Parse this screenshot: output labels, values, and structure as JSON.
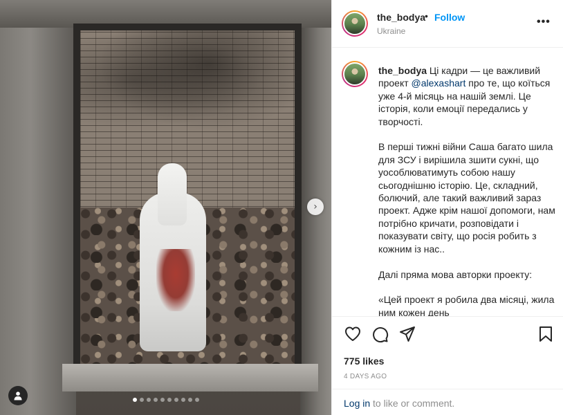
{
  "post": {
    "username": "the_bodya",
    "bullet": "•",
    "follow_label": "Follow",
    "location": "Ukraine",
    "more_label": "•••",
    "caption": {
      "username": "the_bodya",
      "text_before_mention": " Ці кадри — це важливий проект ",
      "mention": "@alexashart",
      "text_after_mention": " про те, що коїться уже 4-й місяць на нашій землі. Це історія, коли емоції передались у творчості.\n\nВ перші тижні війни Саша багато шила для ЗСУ і вирішила зшити сукні, що уособлюватимуть собою нашу сьогоднішню історію. Це, складний, болючий, але такий важливий зараз проект. Адже крім нашої допомоги, нам потрібно кричати, розповідати і показувати світу, що росія робить з кожним із нас..\n\nДалі пряма мова авторки проекту:\n\n«Цей проект я робила два місяці, жила ним кожен день"
    },
    "likes": "775 likes",
    "date": "4 DAYS AGO",
    "login_link": "Log in",
    "login_suffix": " to like or comment."
  },
  "carousel": {
    "dot_count": 10,
    "active_index": 0,
    "next_glyph": "›"
  },
  "icons": {
    "like": "heart-icon",
    "comment": "comment-icon",
    "share": "send-icon",
    "save": "bookmark-icon",
    "tag": "user-tag-icon",
    "next": "chevron-right-icon",
    "more": "more-options-icon"
  },
  "colors": {
    "follow": "#0095f6",
    "mention": "#00376b",
    "muted": "#8e8e8e",
    "text": "#262626"
  }
}
